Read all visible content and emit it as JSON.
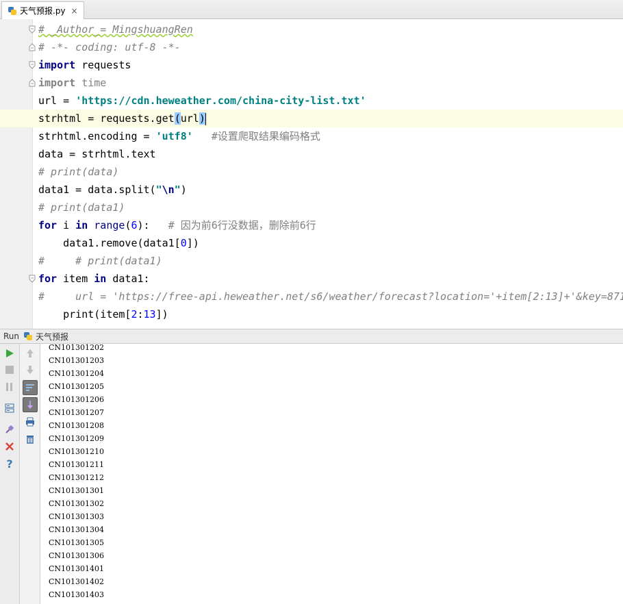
{
  "tab": {
    "filename": "天气预报.py",
    "close": "×"
  },
  "code": {
    "l1": "# _Author_= MingshuangRen",
    "l2": "# -*- coding: utf-8 -*-",
    "l3_kw": "import",
    "l3_rest": " requests",
    "l4_kw": "import",
    "l4_rest": " time",
    "l5_a": "url = ",
    "l5_str": "'https://cdn.heweather.com/china-city-list.txt'",
    "l6_a": "strhtml = requests.get",
    "l6_p1": "(",
    "l6_b": "url",
    "l6_p2": ")",
    "l7_a": "strhtml.encoding = ",
    "l7_str": "'utf8'",
    "l7_cm": "   #设置爬取结果编码格式",
    "l8": "data = strhtml.text",
    "l9": "# print(data)",
    "l10_a": "data1 = data.split(",
    "l10_str1": "\"",
    "l10_esc": "\\n",
    "l10_str2": "\"",
    "l10_b": ")",
    "l11": "# print(data1)",
    "l12_kw1": "for",
    "l12_a": " i ",
    "l12_kw2": "in",
    "l12_sp": " ",
    "l12_bi": "range",
    "l12_b": "(",
    "l12_num": "6",
    "l12_c": "):",
    "l12_cm": "   # 因为前6行没数据，删除前6行",
    "l13_a": "    data1.remove(data1[",
    "l13_num": "0",
    "l13_b": "])",
    "l14": "#     # print(data1)",
    "l15_kw1": "for",
    "l15_a": " item ",
    "l15_kw2": "in",
    "l15_b": " data1:",
    "l16": "#     url = 'https://free-api.heweather.net/s6/weather/forecast?location='+item[2:13]+'&key=871",
    "l17_a": "    print(item[",
    "l17_num1": "2",
    "l17_b": ":",
    "l17_num2": "13",
    "l17_c": "])"
  },
  "run": {
    "label": "Run",
    "config_name": "天气预报"
  },
  "output": [
    "CN101301202",
    "CN101301203",
    "CN101301204",
    "CN101301205",
    "CN101301206",
    "CN101301207",
    "CN101301208",
    "CN101301209",
    "CN101301210",
    "CN101301211",
    "CN101301212",
    "CN101301301",
    "CN101301302",
    "CN101301303",
    "CN101301304",
    "CN101301305",
    "CN101301306",
    "CN101301401",
    "CN101301402",
    "CN101301403"
  ],
  "colors": {
    "keyword": "#000080",
    "string": "#008080",
    "comment": "#808080",
    "number": "#0000ff",
    "caret_line": "#fcfbe3"
  }
}
